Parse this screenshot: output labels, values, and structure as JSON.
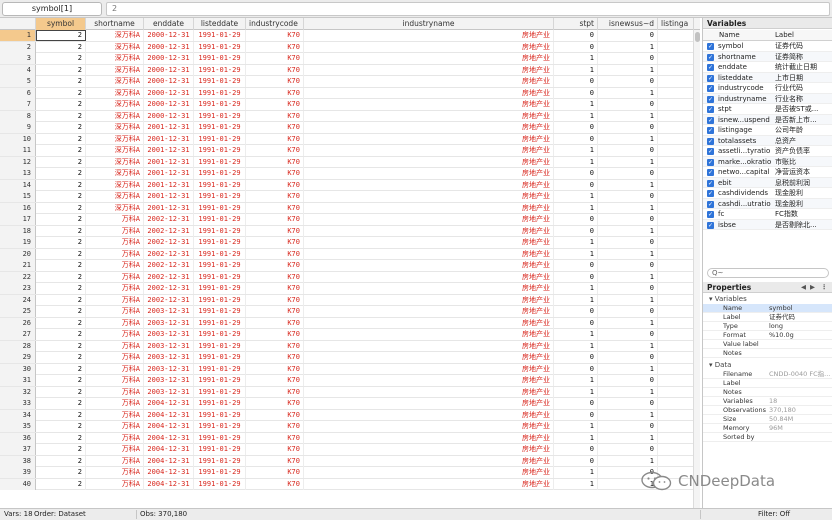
{
  "topbar": {
    "varname": "symbol[1]",
    "value": "2"
  },
  "columns": [
    {
      "key": "rownum",
      "label": ""
    },
    {
      "key": "symbol",
      "label": "symbol"
    },
    {
      "key": "shortname",
      "label": "shortname"
    },
    {
      "key": "enddate",
      "label": "enddate"
    },
    {
      "key": "listeddate",
      "label": "listeddate"
    },
    {
      "key": "industrycode",
      "label": "industrycode"
    },
    {
      "key": "industryname",
      "label": "industryname"
    },
    {
      "key": "stpt",
      "label": "stpt"
    },
    {
      "key": "isnew",
      "label": "isnewsus~d"
    },
    {
      "key": "listinga",
      "label": "listinga"
    }
  ],
  "rows": [
    {
      "n": "1",
      "symbol": "2",
      "shortname": "深万科A",
      "enddate": "2000-12-31",
      "listeddate": "1991-01-29",
      "industrycode": "K70",
      "industryname": "房地产业",
      "stpt": "0",
      "isnew": "0"
    },
    {
      "n": "2",
      "symbol": "2",
      "shortname": "深万科A",
      "enddate": "2000-12-31",
      "listeddate": "1991-01-29",
      "industrycode": "K70",
      "industryname": "房地产业",
      "stpt": "0",
      "isnew": "1"
    },
    {
      "n": "3",
      "symbol": "2",
      "shortname": "深万科A",
      "enddate": "2000-12-31",
      "listeddate": "1991-01-29",
      "industrycode": "K70",
      "industryname": "房地产业",
      "stpt": "1",
      "isnew": "0"
    },
    {
      "n": "4",
      "symbol": "2",
      "shortname": "深万科A",
      "enddate": "2000-12-31",
      "listeddate": "1991-01-29",
      "industrycode": "K70",
      "industryname": "房地产业",
      "stpt": "1",
      "isnew": "1"
    },
    {
      "n": "5",
      "symbol": "2",
      "shortname": "深万科A",
      "enddate": "2000-12-31",
      "listeddate": "1991-01-29",
      "industrycode": "K70",
      "industryname": "房地产业",
      "stpt": "0",
      "isnew": "0"
    },
    {
      "n": "6",
      "symbol": "2",
      "shortname": "深万科A",
      "enddate": "2000-12-31",
      "listeddate": "1991-01-29",
      "industrycode": "K70",
      "industryname": "房地产业",
      "stpt": "0",
      "isnew": "1"
    },
    {
      "n": "7",
      "symbol": "2",
      "shortname": "深万科A",
      "enddate": "2000-12-31",
      "listeddate": "1991-01-29",
      "industrycode": "K70",
      "industryname": "房地产业",
      "stpt": "1",
      "isnew": "0"
    },
    {
      "n": "8",
      "symbol": "2",
      "shortname": "深万科A",
      "enddate": "2000-12-31",
      "listeddate": "1991-01-29",
      "industrycode": "K70",
      "industryname": "房地产业",
      "stpt": "1",
      "isnew": "1"
    },
    {
      "n": "9",
      "symbol": "2",
      "shortname": "深万科A",
      "enddate": "2001-12-31",
      "listeddate": "1991-01-29",
      "industrycode": "K70",
      "industryname": "房地产业",
      "stpt": "0",
      "isnew": "0"
    },
    {
      "n": "10",
      "symbol": "2",
      "shortname": "深万科A",
      "enddate": "2001-12-31",
      "listeddate": "1991-01-29",
      "industrycode": "K70",
      "industryname": "房地产业",
      "stpt": "0",
      "isnew": "1"
    },
    {
      "n": "11",
      "symbol": "2",
      "shortname": "深万科A",
      "enddate": "2001-12-31",
      "listeddate": "1991-01-29",
      "industrycode": "K70",
      "industryname": "房地产业",
      "stpt": "1",
      "isnew": "0"
    },
    {
      "n": "12",
      "symbol": "2",
      "shortname": "深万科A",
      "enddate": "2001-12-31",
      "listeddate": "1991-01-29",
      "industrycode": "K70",
      "industryname": "房地产业",
      "stpt": "1",
      "isnew": "1"
    },
    {
      "n": "13",
      "symbol": "2",
      "shortname": "深万科A",
      "enddate": "2001-12-31",
      "listeddate": "1991-01-29",
      "industrycode": "K70",
      "industryname": "房地产业",
      "stpt": "0",
      "isnew": "0"
    },
    {
      "n": "14",
      "symbol": "2",
      "shortname": "深万科A",
      "enddate": "2001-12-31",
      "listeddate": "1991-01-29",
      "industrycode": "K70",
      "industryname": "房地产业",
      "stpt": "0",
      "isnew": "1"
    },
    {
      "n": "15",
      "symbol": "2",
      "shortname": "深万科A",
      "enddate": "2001-12-31",
      "listeddate": "1991-01-29",
      "industrycode": "K70",
      "industryname": "房地产业",
      "stpt": "1",
      "isnew": "0"
    },
    {
      "n": "16",
      "symbol": "2",
      "shortname": "深万科A",
      "enddate": "2001-12-31",
      "listeddate": "1991-01-29",
      "industrycode": "K70",
      "industryname": "房地产业",
      "stpt": "1",
      "isnew": "1"
    },
    {
      "n": "17",
      "symbol": "2",
      "shortname": "万科A",
      "enddate": "2002-12-31",
      "listeddate": "1991-01-29",
      "industrycode": "K70",
      "industryname": "房地产业",
      "stpt": "0",
      "isnew": "0"
    },
    {
      "n": "18",
      "symbol": "2",
      "shortname": "万科A",
      "enddate": "2002-12-31",
      "listeddate": "1991-01-29",
      "industrycode": "K70",
      "industryname": "房地产业",
      "stpt": "0",
      "isnew": "1"
    },
    {
      "n": "19",
      "symbol": "2",
      "shortname": "万科A",
      "enddate": "2002-12-31",
      "listeddate": "1991-01-29",
      "industrycode": "K70",
      "industryname": "房地产业",
      "stpt": "1",
      "isnew": "0"
    },
    {
      "n": "20",
      "symbol": "2",
      "shortname": "万科A",
      "enddate": "2002-12-31",
      "listeddate": "1991-01-29",
      "industrycode": "K70",
      "industryname": "房地产业",
      "stpt": "1",
      "isnew": "1"
    },
    {
      "n": "21",
      "symbol": "2",
      "shortname": "万科A",
      "enddate": "2002-12-31",
      "listeddate": "1991-01-29",
      "industrycode": "K70",
      "industryname": "房地产业",
      "stpt": "0",
      "isnew": "0"
    },
    {
      "n": "22",
      "symbol": "2",
      "shortname": "万科A",
      "enddate": "2002-12-31",
      "listeddate": "1991-01-29",
      "industrycode": "K70",
      "industryname": "房地产业",
      "stpt": "0",
      "isnew": "1"
    },
    {
      "n": "23",
      "symbol": "2",
      "shortname": "万科A",
      "enddate": "2002-12-31",
      "listeddate": "1991-01-29",
      "industrycode": "K70",
      "industryname": "房地产业",
      "stpt": "1",
      "isnew": "0"
    },
    {
      "n": "24",
      "symbol": "2",
      "shortname": "万科A",
      "enddate": "2002-12-31",
      "listeddate": "1991-01-29",
      "industrycode": "K70",
      "industryname": "房地产业",
      "stpt": "1",
      "isnew": "1"
    },
    {
      "n": "25",
      "symbol": "2",
      "shortname": "万科A",
      "enddate": "2003-12-31",
      "listeddate": "1991-01-29",
      "industrycode": "K70",
      "industryname": "房地产业",
      "stpt": "0",
      "isnew": "0"
    },
    {
      "n": "26",
      "symbol": "2",
      "shortname": "万科A",
      "enddate": "2003-12-31",
      "listeddate": "1991-01-29",
      "industrycode": "K70",
      "industryname": "房地产业",
      "stpt": "0",
      "isnew": "1"
    },
    {
      "n": "27",
      "symbol": "2",
      "shortname": "万科A",
      "enddate": "2003-12-31",
      "listeddate": "1991-01-29",
      "industrycode": "K70",
      "industryname": "房地产业",
      "stpt": "1",
      "isnew": "0"
    },
    {
      "n": "28",
      "symbol": "2",
      "shortname": "万科A",
      "enddate": "2003-12-31",
      "listeddate": "1991-01-29",
      "industrycode": "K70",
      "industryname": "房地产业",
      "stpt": "1",
      "isnew": "1"
    },
    {
      "n": "29",
      "symbol": "2",
      "shortname": "万科A",
      "enddate": "2003-12-31",
      "listeddate": "1991-01-29",
      "industrycode": "K70",
      "industryname": "房地产业",
      "stpt": "0",
      "isnew": "0"
    },
    {
      "n": "30",
      "symbol": "2",
      "shortname": "万科A",
      "enddate": "2003-12-31",
      "listeddate": "1991-01-29",
      "industrycode": "K70",
      "industryname": "房地产业",
      "stpt": "0",
      "isnew": "1"
    },
    {
      "n": "31",
      "symbol": "2",
      "shortname": "万科A",
      "enddate": "2003-12-31",
      "listeddate": "1991-01-29",
      "industrycode": "K70",
      "industryname": "房地产业",
      "stpt": "1",
      "isnew": "0"
    },
    {
      "n": "32",
      "symbol": "2",
      "shortname": "万科A",
      "enddate": "2003-12-31",
      "listeddate": "1991-01-29",
      "industrycode": "K70",
      "industryname": "房地产业",
      "stpt": "1",
      "isnew": "1"
    },
    {
      "n": "33",
      "symbol": "2",
      "shortname": "万科A",
      "enddate": "2004-12-31",
      "listeddate": "1991-01-29",
      "industrycode": "K70",
      "industryname": "房地产业",
      "stpt": "0",
      "isnew": "0"
    },
    {
      "n": "34",
      "symbol": "2",
      "shortname": "万科A",
      "enddate": "2004-12-31",
      "listeddate": "1991-01-29",
      "industrycode": "K70",
      "industryname": "房地产业",
      "stpt": "0",
      "isnew": "1"
    },
    {
      "n": "35",
      "symbol": "2",
      "shortname": "万科A",
      "enddate": "2004-12-31",
      "listeddate": "1991-01-29",
      "industrycode": "K70",
      "industryname": "房地产业",
      "stpt": "1",
      "isnew": "0"
    },
    {
      "n": "36",
      "symbol": "2",
      "shortname": "万科A",
      "enddate": "2004-12-31",
      "listeddate": "1991-01-29",
      "industrycode": "K70",
      "industryname": "房地产业",
      "stpt": "1",
      "isnew": "1"
    },
    {
      "n": "37",
      "symbol": "2",
      "shortname": "万科A",
      "enddate": "2004-12-31",
      "listeddate": "1991-01-29",
      "industrycode": "K70",
      "industryname": "房地产业",
      "stpt": "0",
      "isnew": "0"
    },
    {
      "n": "38",
      "symbol": "2",
      "shortname": "万科A",
      "enddate": "2004-12-31",
      "listeddate": "1991-01-29",
      "industrycode": "K70",
      "industryname": "房地产业",
      "stpt": "0",
      "isnew": "1"
    },
    {
      "n": "39",
      "symbol": "2",
      "shortname": "万科A",
      "enddate": "2004-12-31",
      "listeddate": "1991-01-29",
      "industrycode": "K70",
      "industryname": "房地产业",
      "stpt": "1",
      "isnew": "0"
    },
    {
      "n": "40",
      "symbol": "2",
      "shortname": "万科A",
      "enddate": "2004-12-31",
      "listeddate": "1991-01-29",
      "industrycode": "K70",
      "industryname": "房地产业",
      "stpt": "1",
      "isnew": "1"
    }
  ],
  "variables_panel": {
    "title": "Variables",
    "col_name": "Name",
    "col_label": "Label",
    "items": [
      {
        "name": "symbol",
        "label": "证券代码"
      },
      {
        "name": "shortname",
        "label": "证券简称"
      },
      {
        "name": "enddate",
        "label": "统计截止日期"
      },
      {
        "name": "listeddate",
        "label": "上市日期"
      },
      {
        "name": "industrycode",
        "label": "行业代码"
      },
      {
        "name": "industryname",
        "label": "行业名称"
      },
      {
        "name": "stpt",
        "label": "是否被ST或..."
      },
      {
        "name": "isnew...uspend",
        "label": "是否新上市..."
      },
      {
        "name": "listingage",
        "label": "公司年龄"
      },
      {
        "name": "totalassets",
        "label": "总资产"
      },
      {
        "name": "assetli...tyratio",
        "label": "资产负债率"
      },
      {
        "name": "marke...okratio",
        "label": "市账比"
      },
      {
        "name": "netwo...capital",
        "label": "净营运资本"
      },
      {
        "name": "ebit",
        "label": "息税前利润"
      },
      {
        "name": "cashdividends",
        "label": "现金股利"
      },
      {
        "name": "cashdi...utratio",
        "label": "现金股利"
      },
      {
        "name": "fc",
        "label": "FC指数"
      },
      {
        "name": "isbse",
        "label": "是否剔除北..."
      }
    ],
    "filter_placeholder": "Q~"
  },
  "properties_panel": {
    "title": "Properties",
    "variables_section": "Variables",
    "variables": [
      {
        "key": "Name",
        "value": "symbol"
      },
      {
        "key": "Label",
        "value": "证券代码"
      },
      {
        "key": "Type",
        "value": "long"
      },
      {
        "key": "Format",
        "value": "%10.0g"
      },
      {
        "key": "Value label",
        "value": ""
      },
      {
        "key": "Notes",
        "value": ""
      }
    ],
    "data_section": "Data",
    "data": [
      {
        "key": "Filename",
        "value": "CNDD-0040 FC指..."
      },
      {
        "key": "Label",
        "value": ""
      },
      {
        "key": "Notes",
        "value": ""
      },
      {
        "key": "Variables",
        "value": "18"
      },
      {
        "key": "Observations",
        "value": "370,180"
      },
      {
        "key": "Size",
        "value": "50.84M"
      },
      {
        "key": "Memory",
        "value": "96M"
      },
      {
        "key": "Sorted by",
        "value": ""
      }
    ]
  },
  "status": {
    "vars": "Vars: 18",
    "order": "Order: Dataset",
    "obs": "Obs: 370,180",
    "filter": "Filter: Off"
  },
  "watermark": {
    "text": "CNDeepData"
  },
  "icons": {
    "checkbox": "checkbox-checked-icon",
    "search": "search-icon",
    "nav_prev": "arrow-left-icon",
    "nav_next": "arrow-right-icon",
    "expand": "triangle-icon",
    "wechat": "wechat-logo-icon"
  },
  "colors": {
    "text_red": "#d8261c",
    "selected_header": "#f4c98d",
    "checkbox_blue": "#2f74d9"
  }
}
